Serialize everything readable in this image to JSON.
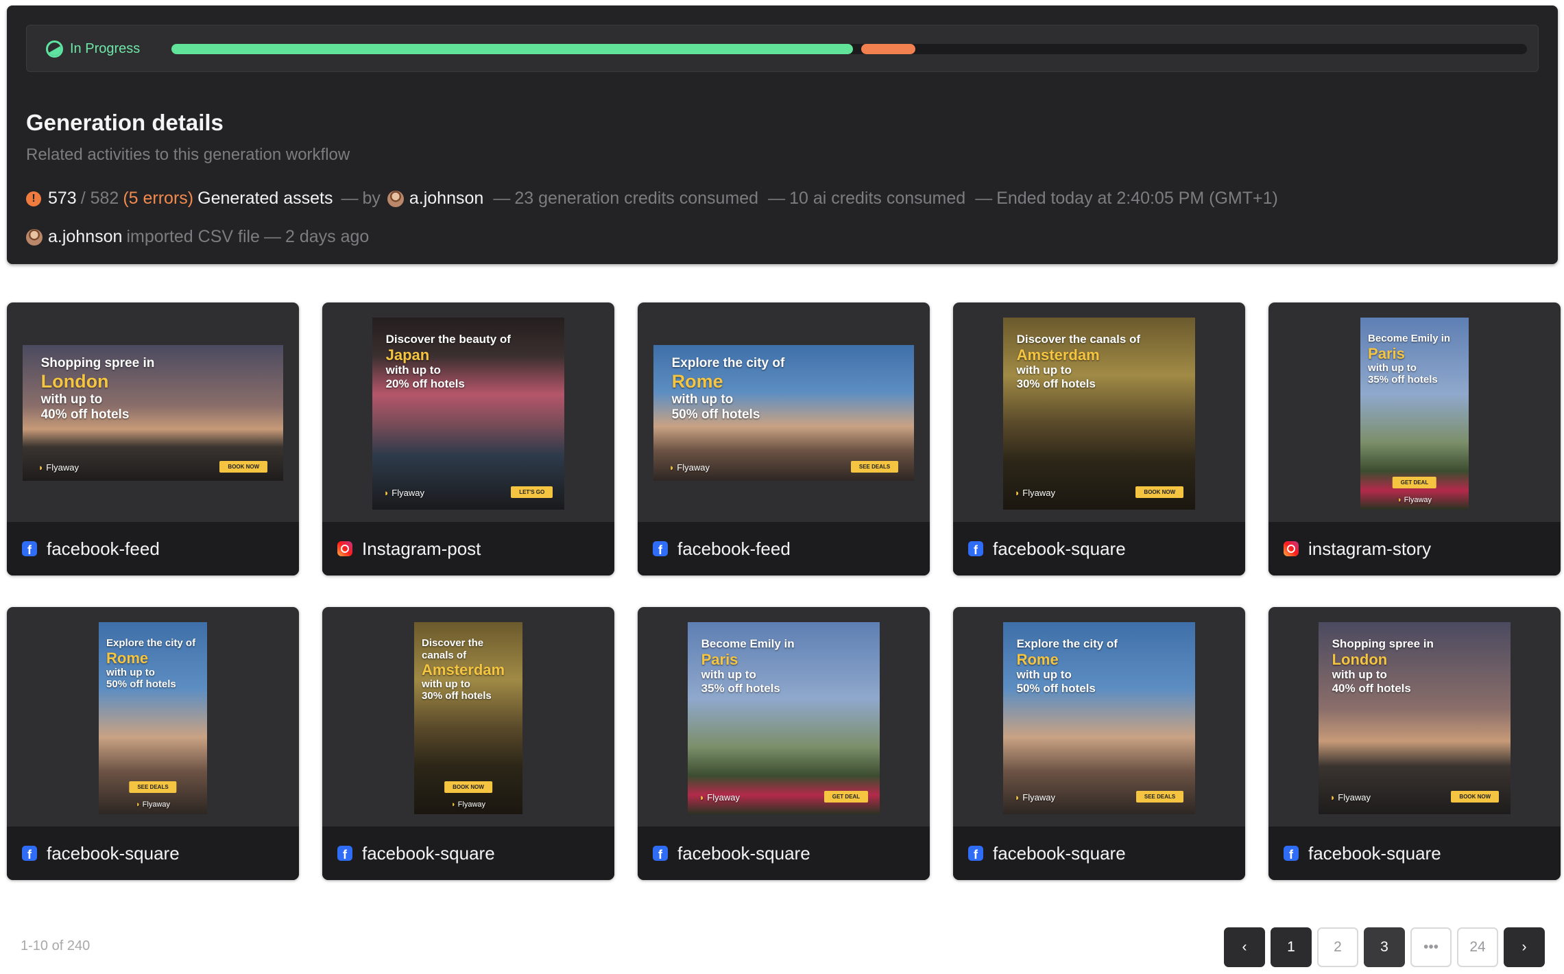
{
  "status": {
    "label": "In Progress",
    "success_fraction": 0.503,
    "error_fraction": 0.04
  },
  "details": {
    "title": "Generation details",
    "subtitle": "Related activities to this generation workflow",
    "generated_count": "573",
    "total_count": "/ 582",
    "errors": "(5 errors)",
    "generated_label": "Generated assets",
    "by_label": "by",
    "user": "a.johnson",
    "gen_credits": "23 generation credits consumed",
    "ai_credits": "10 ai credits consumed",
    "ended": "Ended today at 2:40:05 PM (GMT+1)",
    "dash": "—",
    "import_user": "a.johnson",
    "import_action": "imported CSV file",
    "import_time": "2 days ago"
  },
  "cards": [
    {
      "label": "facebook-feed",
      "platform": "facebook",
      "ad": {
        "line1": "Shopping spree in",
        "city": "London",
        "line2": "with up to",
        "line3": "40% off hotels",
        "cta": "BOOK NOW",
        "brand": "Flyaway"
      }
    },
    {
      "label": "Instagram-post",
      "platform": "instagram",
      "ad": {
        "line1": "Discover the beauty of",
        "city": "Japan",
        "line2": "with up to",
        "line3": "20% off hotels",
        "cta": "LET'S GO",
        "brand": "Flyaway"
      }
    },
    {
      "label": "facebook-feed",
      "platform": "facebook",
      "ad": {
        "line1": "Explore the city of",
        "city": "Rome",
        "line2": "with up to",
        "line3": "50% off hotels",
        "cta": "SEE DEALS",
        "brand": "Flyaway"
      }
    },
    {
      "label": "facebook-square",
      "platform": "facebook",
      "ad": {
        "line1": "Discover the canals of",
        "city": "Amsterdam",
        "line2": "with up to",
        "line3": "30% off hotels",
        "cta": "BOOK NOW",
        "brand": "Flyaway"
      }
    },
    {
      "label": "instagram-story",
      "platform": "instagram",
      "ad": {
        "line1": "Become Emily in",
        "city": "Paris",
        "line2": "with up to",
        "line3": "35% off hotels",
        "cta": "GET DEAL",
        "brand": "Flyaway"
      }
    },
    {
      "label": "facebook-square",
      "platform": "facebook",
      "ad": {
        "line1": "Explore the city of",
        "city": "Rome",
        "line2": "with up to",
        "line3": "50% off hotels",
        "cta": "SEE DEALS",
        "brand": "Flyaway"
      }
    },
    {
      "label": "facebook-square",
      "platform": "facebook",
      "ad": {
        "line1": "Discover the canals of",
        "city": "Amsterdam",
        "line2": "with up to",
        "line3": "30% off hotels",
        "cta": "BOOK NOW",
        "brand": "Flyaway"
      }
    },
    {
      "label": "facebook-square",
      "platform": "facebook",
      "ad": {
        "line1": "Become Emily in",
        "city": "Paris",
        "line2": "with up to",
        "line3": "35% off hotels",
        "cta": "GET DEAL",
        "brand": "Flyaway"
      }
    },
    {
      "label": "facebook-square",
      "platform": "facebook",
      "ad": {
        "line1": "Explore the city of",
        "city": "Rome",
        "line2": "with up to",
        "line3": "50% off hotels",
        "cta": "SEE DEALS",
        "brand": "Flyaway"
      }
    },
    {
      "label": "facebook-square",
      "platform": "facebook",
      "ad": {
        "line1": "Shopping spree in",
        "city": "London",
        "line2": "with up to",
        "line3": "40% off hotels",
        "cta": "BOOK NOW",
        "brand": "Flyaway"
      }
    }
  ],
  "pagination": {
    "range": "1-10 of 240",
    "pages": [
      "1",
      "2",
      "3",
      "•••",
      "24"
    ],
    "current": "3"
  },
  "colors": {
    "accent_green": "#62e39a",
    "error_orange": "#f3804f",
    "panel_bg": "#232325",
    "facebook_blue": "#2f6df6"
  }
}
